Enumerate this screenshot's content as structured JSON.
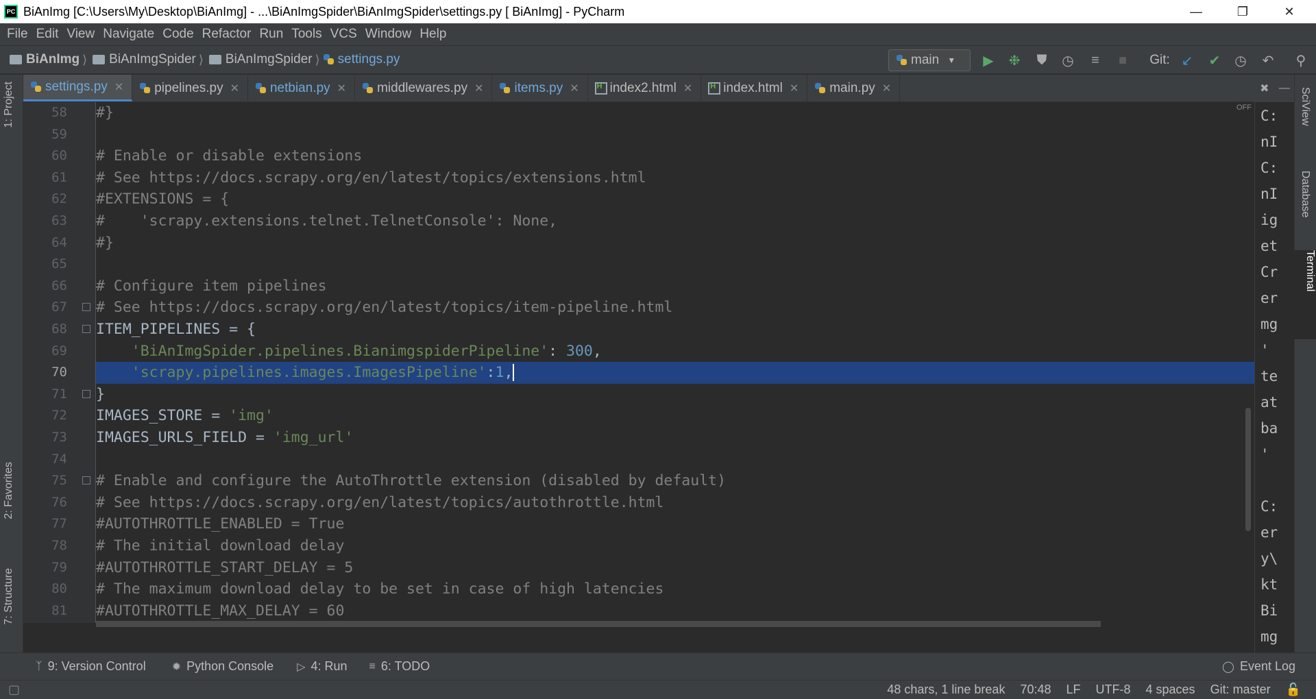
{
  "window": {
    "title": "BiAnImg [C:\\Users\\My\\Desktop\\BiAnImg] - ...\\BiAnImgSpider\\BiAnImgSpider\\settings.py [ BiAnImg] - PyCharm",
    "app_icon_text": "PC"
  },
  "menu": [
    "File",
    "Edit",
    "View",
    "Navigate",
    "Code",
    "Refactor",
    "Run",
    "Tools",
    "VCS",
    "Window",
    "Help"
  ],
  "breadcrumb": {
    "items": [
      "BiAnImg",
      "BiAnImgSpider",
      "BiAnImgSpider",
      "settings.py"
    ]
  },
  "run_config": {
    "label": "main"
  },
  "git_label": "Git:",
  "tabs": [
    {
      "label": "settings.py",
      "active": true,
      "kind": "py"
    },
    {
      "label": "pipelines.py",
      "active": false,
      "kind": "py"
    },
    {
      "label": "netbian.py",
      "active": false,
      "kind": "py"
    },
    {
      "label": "middlewares.py",
      "active": false,
      "kind": "py"
    },
    {
      "label": "items.py",
      "active": false,
      "kind": "py"
    },
    {
      "label": "index2.html",
      "active": false,
      "kind": "html"
    },
    {
      "label": "index.html",
      "active": false,
      "kind": "html"
    },
    {
      "label": "main.py",
      "active": false,
      "kind": "py"
    }
  ],
  "left_tool_windows": [
    "1: Project",
    "2: Favorites",
    "7: Structure"
  ],
  "right_tool_windows": [
    "SciView",
    "Database",
    "Terminal"
  ],
  "code": {
    "line_numbers": [
      "58",
      "59",
      "60",
      "61",
      "62",
      "63",
      "64",
      "65",
      "66",
      "67",
      "68",
      "69",
      "70",
      "71",
      "72",
      "73",
      "74",
      "75",
      "76",
      "77",
      "78",
      "79",
      "80",
      "81"
    ],
    "current_line": "70",
    "l58": "#}",
    "l60": "# Enable or disable extensions",
    "l61": "# See https://docs.scrapy.org/en/latest/topics/extensions.html",
    "l62": "#EXTENSIONS = {",
    "l63": "#    'scrapy.extensions.telnet.TelnetConsole': None,",
    "l64": "#}",
    "l66": "# Configure item pipelines",
    "l67": "# See https://docs.scrapy.org/en/latest/topics/item-pipeline.html",
    "l68": "ITEM_PIPELINES = {",
    "l69_str": "'BiAnImgSpider.pipelines.BianimgspiderPipeline'",
    "l69_sep": ": ",
    "l69_num": "300",
    "l69_end": ",",
    "l70_str": "'scrapy.pipelines.images.ImagesPipeline'",
    "l70_sep": ":",
    "l70_num": "1",
    "l70_end": ",",
    "l71": "}",
    "l72_key": "IMAGES_STORE = ",
    "l72_val": "'img'",
    "l73_key": "IMAGES_URLS_FIELD = ",
    "l73_val": "'img_url'",
    "l75": "# Enable and configure the AutoThrottle extension (disabled by default)",
    "l76": "# See https://docs.scrapy.org/en/latest/topics/autothrottle.html",
    "l77": "#AUTOTHROTTLE_ENABLED = True",
    "l78": "# The initial download delay",
    "l79": "#AUTOTHROTTLE_START_DELAY = 5",
    "l80": "# The maximum download delay to be set in case of high latencies",
    "l81": "#AUTOTHROTTLE_MAX_DELAY = 60"
  },
  "terminal_lines": [
    "C:",
    "nI",
    "C:",
    "nI",
    "ig",
    "et",
    "Cr",
    "er",
    "mg",
    "'",
    "te",
    "at",
    "ba",
    "'",
    "",
    "C:",
    "er",
    "y\\",
    "kt",
    "Bi",
    "mg"
  ],
  "off_label": "OFF",
  "bottom_tools": [
    {
      "label": "9: Version Control"
    },
    {
      "label": "Python Console"
    },
    {
      "label": "4: Run"
    },
    {
      "label": "6: TODO"
    }
  ],
  "event_log": "Event Log",
  "status": {
    "selection": "48 chars, 1 line break",
    "position": "70:48",
    "line_sep": "LF",
    "encoding": "UTF-8",
    "indent": "4 spaces",
    "git": "Git: master"
  }
}
